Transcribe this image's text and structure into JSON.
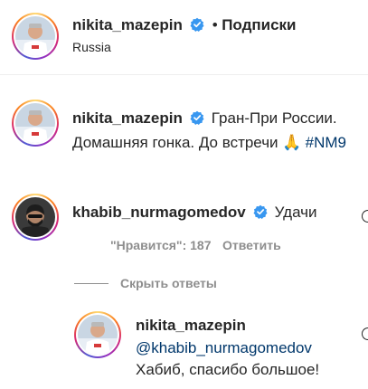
{
  "header": {
    "username": "nikita_mazepin",
    "separator": "•",
    "follow_label": "Подписки",
    "location": "Russia"
  },
  "caption": {
    "username": "nikita_mazepin",
    "text_line1": "Гран-При России.",
    "text_line2": "Домашняя гонка. До встречи",
    "emoji": "🙏",
    "hashtag": "#NM9"
  },
  "comment": {
    "username": "khabib_nurmagomedov",
    "text": "Удачи",
    "likes_label": "\"Нравится\": 187",
    "reply_label": "Ответить"
  },
  "hide_replies_label": "Скрыть ответы",
  "reply": {
    "username": "nikita_mazepin",
    "mention": "@khabib_nurmagomedov",
    "text": "Хабиб, спасибо большое!"
  },
  "colors": {
    "verified_blue": "#3897f0",
    "link": "#00376b",
    "muted": "#8e8e8e"
  },
  "icons": [
    "verified-badge-icon",
    "prayer-hands-emoji-icon",
    "heart-icon"
  ]
}
